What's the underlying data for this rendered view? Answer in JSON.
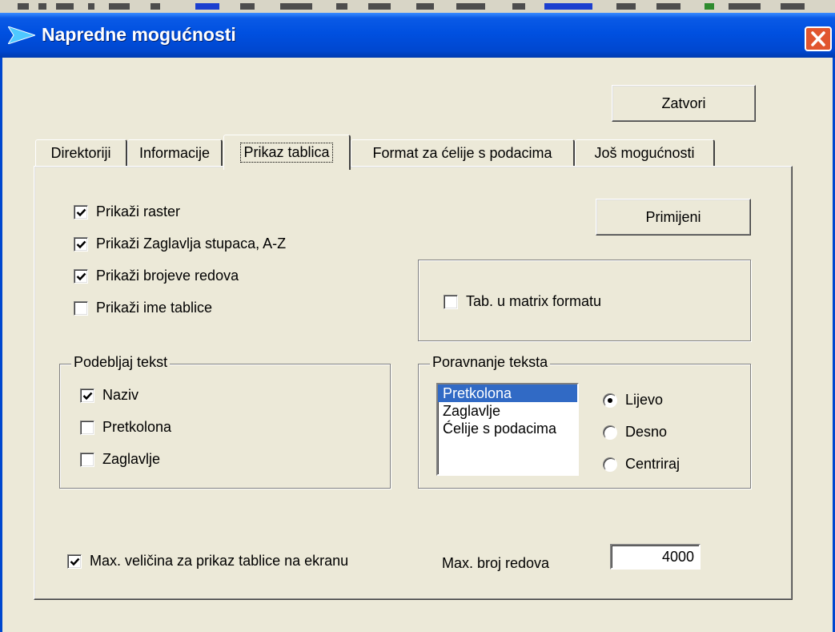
{
  "window": {
    "title": "Napredne mogućnosti"
  },
  "buttons": {
    "close_label": "Zatvori",
    "apply_label": "Primijeni"
  },
  "tabs": [
    {
      "label": "Direktoriji"
    },
    {
      "label": "Informacije"
    },
    {
      "label": "Prikaz tablica"
    },
    {
      "label": "Format za ćelije s podacima"
    },
    {
      "label": "Još mogućnosti"
    }
  ],
  "display_options": [
    {
      "label": "Prikaži raster",
      "checked": true
    },
    {
      "label": "Prikaži Zaglavlja stupaca, A-Z",
      "checked": true
    },
    {
      "label": "Prikaži brojeve redova",
      "checked": true
    },
    {
      "label": "Prikaži ime tablice",
      "checked": false
    }
  ],
  "matrix_option": {
    "label": "Tab. u matrix formatu",
    "checked": false
  },
  "underline_group": {
    "title": "Podebljaj tekst",
    "items": [
      {
        "label": "Naziv",
        "checked": true
      },
      {
        "label": "Pretkolona",
        "checked": false
      },
      {
        "label": "Zaglavlje",
        "checked": false
      }
    ]
  },
  "alignment_group": {
    "title": "Poravnanje teksta",
    "list_items": [
      "Pretkolona",
      "Zaglavlje",
      "Ćelije s podacima"
    ],
    "selected_item": "Pretkolona",
    "radios": [
      {
        "label": "Lijevo",
        "selected": true
      },
      {
        "label": "Desno",
        "selected": false
      },
      {
        "label": "Centriraj",
        "selected": false
      }
    ]
  },
  "max_display": {
    "label": "Max. veličina za prikaz tablice na ekranu",
    "checked": true
  },
  "max_rows": {
    "label": "Max. broj redova",
    "value": "4000"
  },
  "colors": {
    "titlebar": "#0050e0",
    "face": "#ece9d8",
    "selection": "#316ac5",
    "close": "#e1562f"
  }
}
